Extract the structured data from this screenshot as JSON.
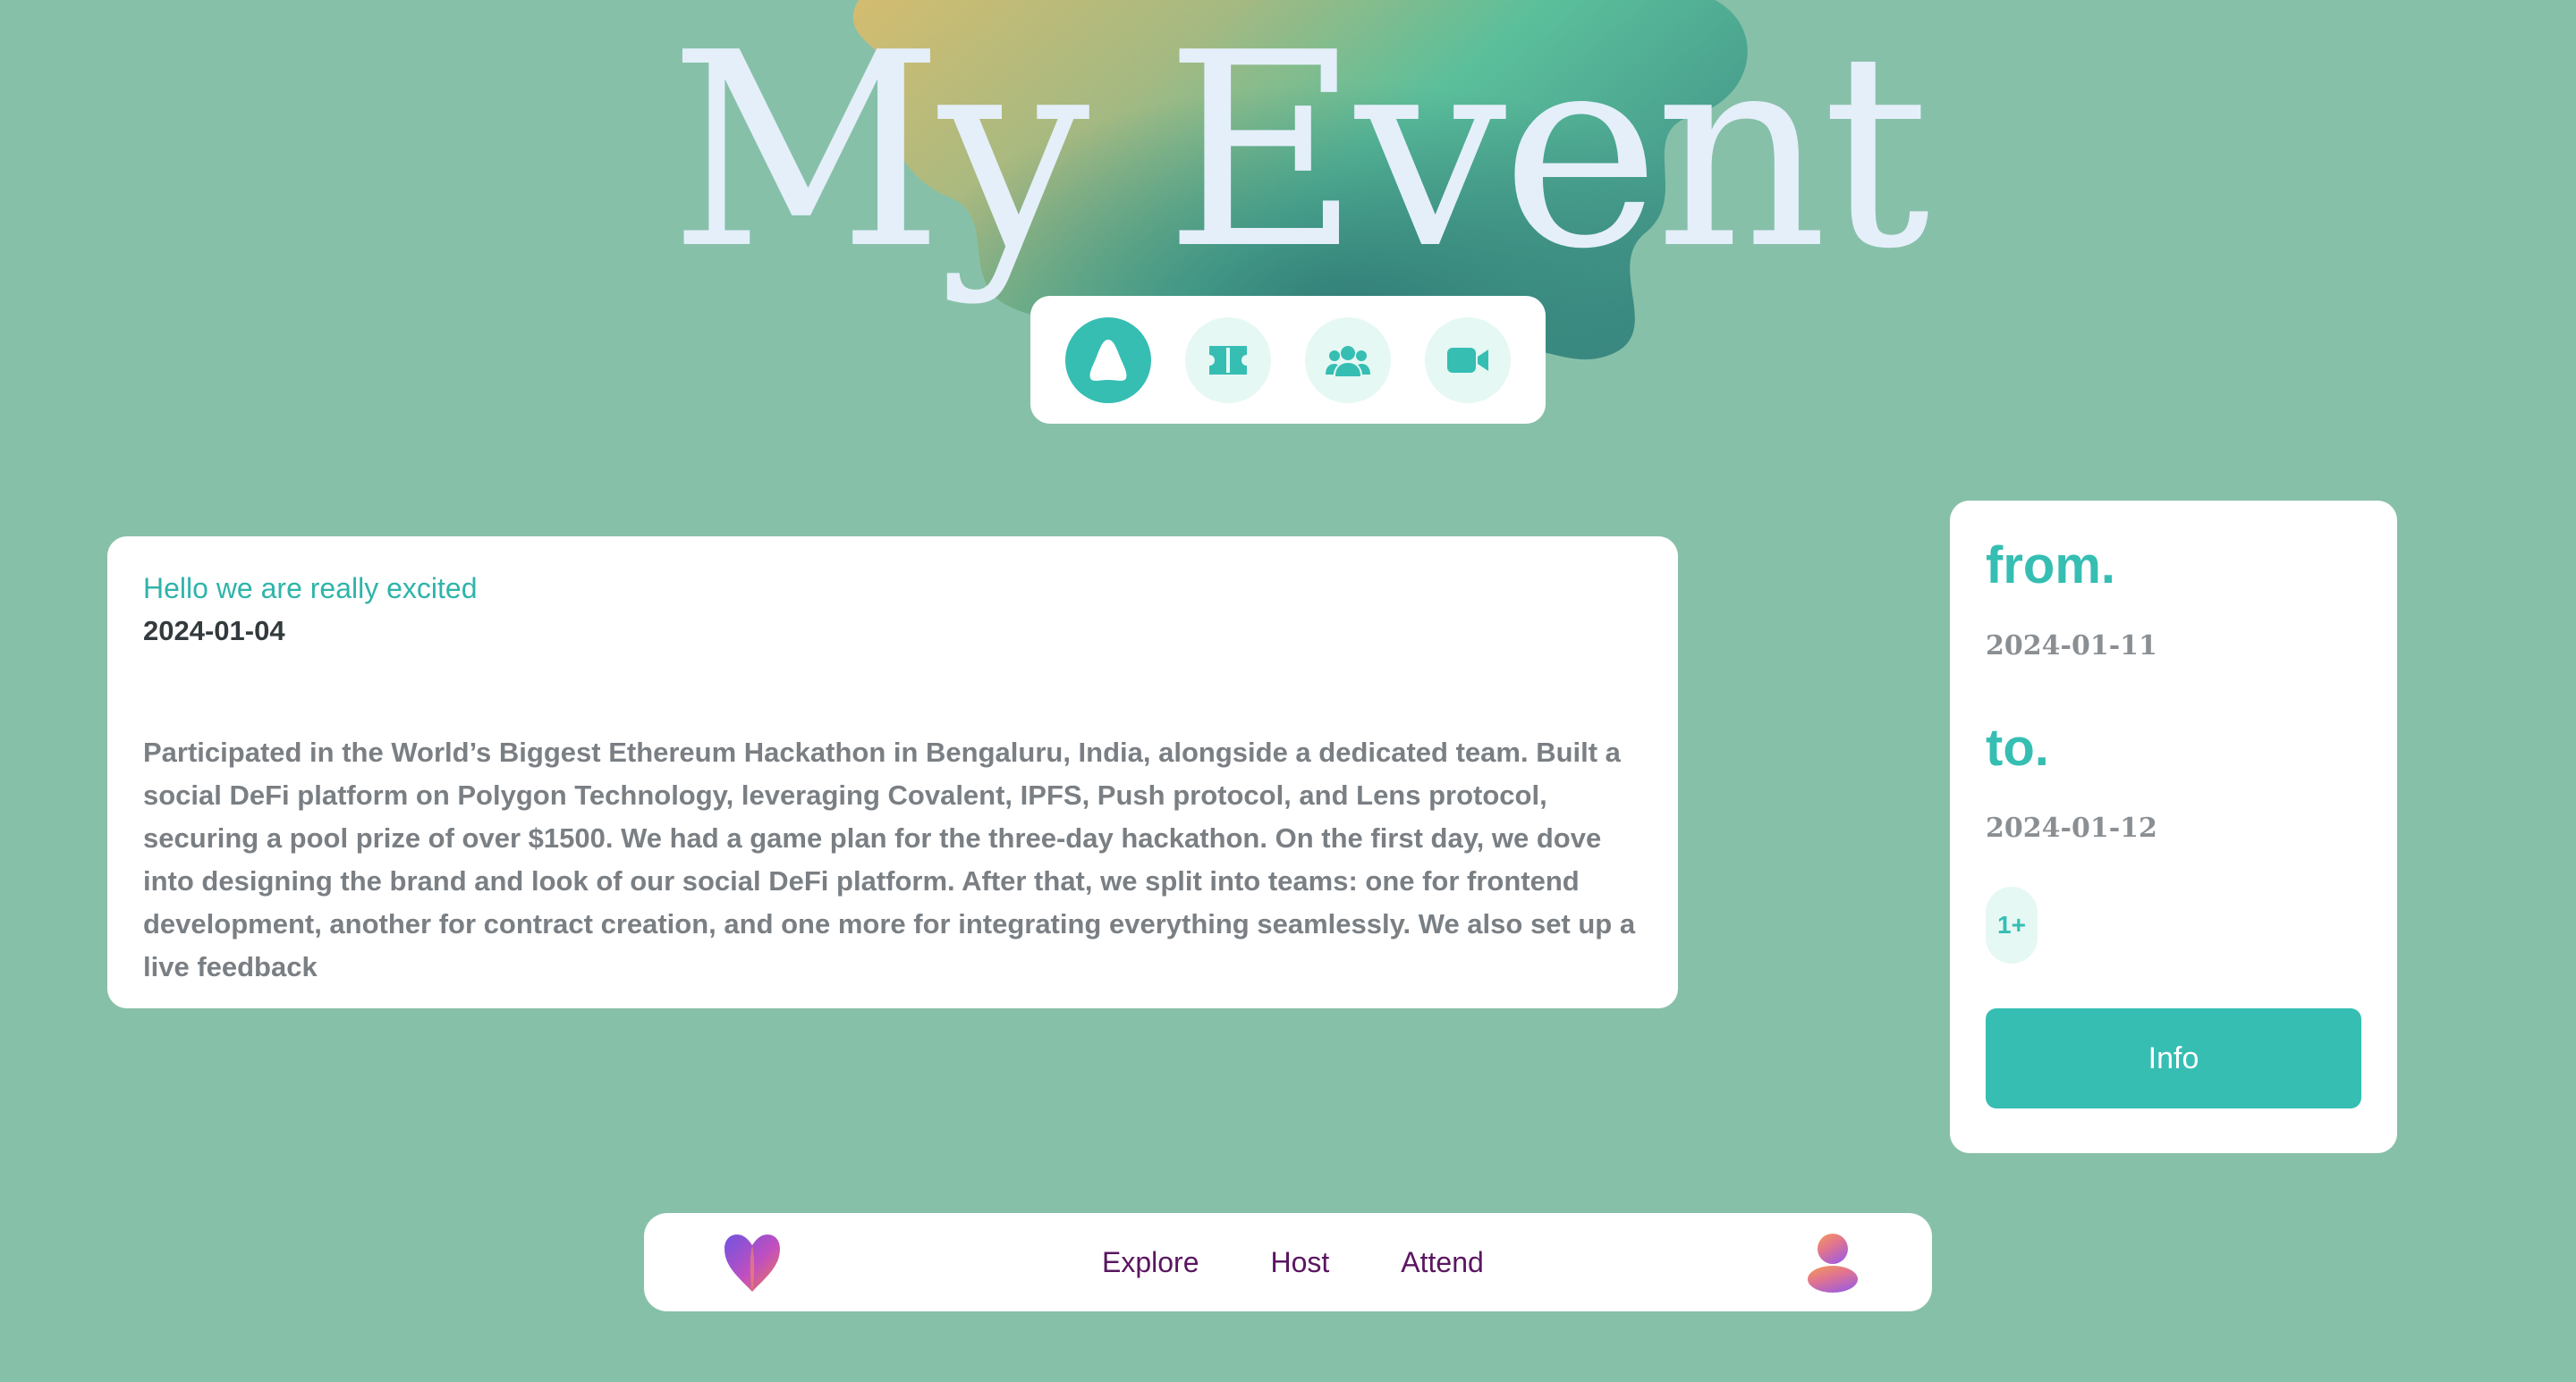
{
  "hero": {
    "title": "My Event"
  },
  "tabs": [
    {
      "icon": "ticket-a-icon",
      "active": true
    },
    {
      "icon": "ticket-icon",
      "active": false
    },
    {
      "icon": "people-icon",
      "active": false
    },
    {
      "icon": "video-camera-icon",
      "active": false
    }
  ],
  "event": {
    "title": "Hello we are really excited",
    "date": "2024-01-04",
    "description": "Participated in the World’s Biggest Ethereum Hackathon in Bengaluru, India, alongside a dedicated team. Built a social DeFi platform on Polygon Technology, leveraging Covalent, IPFS, Push protocol, and Lens protocol, securing a pool prize of over $1500. We had a game plan for the three-day hackathon. On the first day, we dove into designing the brand and look of our social DeFi platform. After that, we split into teams: one for frontend development, another for contract creation, and one more for integrating everything seamlessly. We also set up a live feedback"
  },
  "schedule": {
    "from_label": "from.",
    "from_date": "2024-01-11",
    "to_label": "to.",
    "to_date": "2024-01-12",
    "attendee_count": "1+",
    "info_button": "Info"
  },
  "nav": {
    "links": [
      "Explore",
      "Host",
      "Attend"
    ],
    "logo_icon": "heart-logo-icon",
    "avatar_icon": "user-avatar-icon"
  },
  "colors": {
    "background": "#87c0a8",
    "accent": "#36beb3",
    "title": "#e4effa",
    "nav_link": "#5a1660"
  }
}
